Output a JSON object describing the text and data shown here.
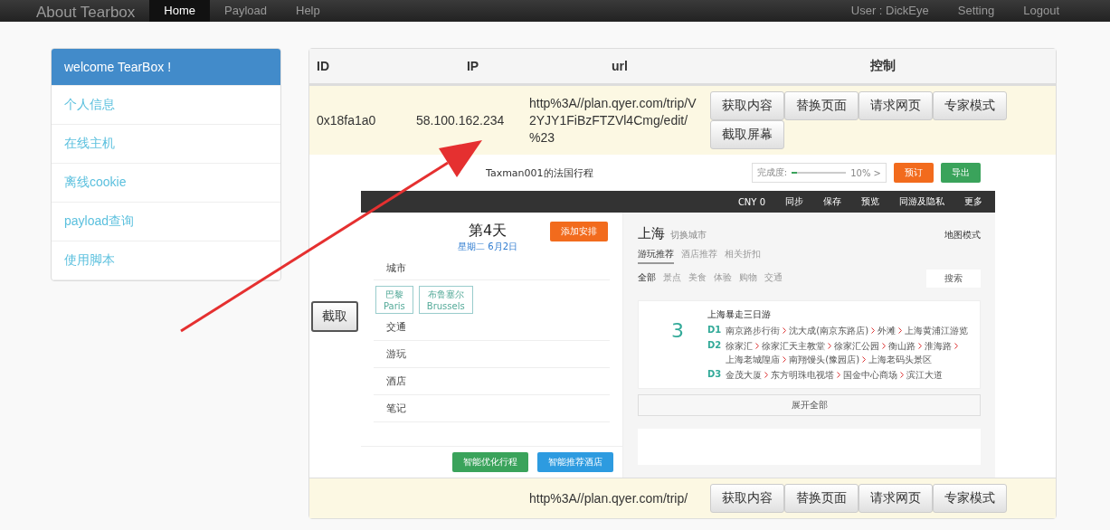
{
  "navbar": {
    "brand": "About Tearbox",
    "items": [
      {
        "label": "Home",
        "selected": true
      },
      {
        "label": "Payload",
        "selected": false
      },
      {
        "label": "Help",
        "selected": false
      }
    ],
    "right": [
      "User : DickEye",
      "Setting",
      "Logout"
    ]
  },
  "sidebar": {
    "items": [
      {
        "label": "welcome TearBox !",
        "selected": true
      },
      {
        "label": "个人信息",
        "selected": false
      },
      {
        "label": "在线主机",
        "selected": false
      },
      {
        "label": "离线cookie",
        "selected": false
      },
      {
        "label": "payload查询",
        "selected": false
      },
      {
        "label": "使用脚本",
        "selected": false
      }
    ]
  },
  "table": {
    "columns": [
      "ID",
      "IP",
      "url",
      "控制"
    ],
    "rows": [
      {
        "id": "0x18fa1a0",
        "ip": "58.100.162.234",
        "url": "http%3A//plan.qyer.com/trip/V2YJY1FiBzFTZVl4Cmg/edit/%23",
        "buttons": [
          "获取内容",
          "替换页面",
          "请求网页",
          "专家模式",
          "截取屏幕"
        ]
      },
      {
        "url": "http%3A//plan.qyer.com/trip/",
        "buttons": [
          "获取内容",
          "替换页面",
          "请求网页",
          "专家模式"
        ]
      }
    ]
  },
  "capture": {
    "button": "截取",
    "preview": {
      "title": "Taxman001的法国行程",
      "progress": {
        "label": "完成度:",
        "level": 0.1,
        "reading": "10% >"
      },
      "actions": [
        {
          "label": "预订",
          "color": "#f26b1d"
        },
        {
          "label": "导出",
          "color": "#3aa35b"
        }
      ],
      "menu": [
        "CNY 0",
        "同步",
        "保存",
        "预览",
        "同游及隐私",
        "更多"
      ],
      "day": {
        "title": "第4天",
        "date": "星期二 6月2日",
        "add": "添加安排",
        "city_label": "城市",
        "cities": [
          {
            "zh": "巴黎",
            "en": "Paris"
          },
          {
            "zh": "布鲁塞尔",
            "en": "Brussels"
          }
        ],
        "sections": [
          "交通",
          "游玩",
          "酒店",
          "笔记"
        ],
        "bottom": [
          {
            "label": "智能优化行程",
            "color": "#3aa35b"
          },
          {
            "label": "智能推荐酒店",
            "color": "#2d9be0"
          }
        ]
      },
      "city": {
        "name": "上海",
        "switch": "切换城市",
        "map": "地图模式",
        "tabs": [
          {
            "label": "游玩推荐",
            "selected": true
          },
          {
            "label": "酒店推荐",
            "selected": false
          },
          {
            "label": "相关折扣",
            "selected": false
          }
        ],
        "filters": [
          {
            "label": "全部",
            "selected": true
          },
          {
            "label": "景点",
            "selected": false
          },
          {
            "label": "美食",
            "selected": false
          },
          {
            "label": "体验",
            "selected": false
          },
          {
            "label": "购物",
            "selected": false
          },
          {
            "label": "交通",
            "selected": false
          }
        ],
        "search": "搜索",
        "card": {
          "number": "3",
          "title": "上海暴走三日游",
          "days": [
            {
              "label": "D1",
              "stops": [
                "南京路步行街",
                "沈大成(南京东路店)",
                "外滩",
                "上海黄浦江游览"
              ]
            },
            {
              "label": "D2",
              "stops": [
                "徐家汇",
                "徐家汇天主教堂",
                "徐家汇公园",
                "衡山路",
                "淮海路",
                "上海老城隍庙",
                "南翔馒头(豫园店)",
                "上海老码头景区"
              ]
            },
            {
              "label": "D3",
              "stops": [
                "金茂大厦",
                "东方明珠电视塔",
                "国金中心商场",
                "滨江大道"
              ]
            }
          ]
        },
        "expand": "展开全部"
      }
    }
  }
}
